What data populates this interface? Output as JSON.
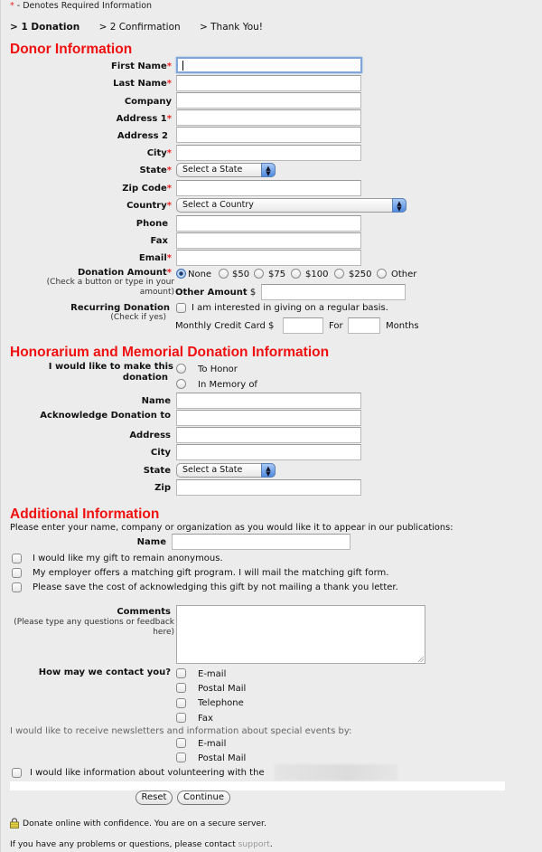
{
  "required_note": {
    "asterisk": "*",
    "text": " - Denotes Required Information"
  },
  "steps": [
    {
      "label": "> 1 Donation",
      "current": true
    },
    {
      "label": "> 2 Confirmation",
      "current": false
    },
    {
      "label": "> Thank You!",
      "current": false
    }
  ],
  "donor": {
    "title": "Donor Information",
    "fields": [
      {
        "label": "First Name",
        "required": true,
        "value": ""
      },
      {
        "label": "Last Name",
        "required": true,
        "value": ""
      },
      {
        "label": "Company",
        "required": false,
        "value": ""
      },
      {
        "label": "Address 1",
        "required": true,
        "value": ""
      },
      {
        "label": "Address 2",
        "required": false,
        "value": ""
      },
      {
        "label": "City",
        "required": true,
        "value": ""
      }
    ],
    "state": {
      "label": "State",
      "required": true,
      "selected": "Select a State"
    },
    "zip": {
      "label": "Zip Code",
      "required": true,
      "value": ""
    },
    "country": {
      "label": "Country",
      "required": true,
      "selected": "Select a Country"
    },
    "phone": {
      "label": "Phone",
      "value": ""
    },
    "fax": {
      "label": "Fax",
      "value": ""
    },
    "email": {
      "label": "Email",
      "required": true,
      "value": ""
    },
    "donation_amount": {
      "label": "Donation Amount",
      "hint": "(Check a button or type in your amount)",
      "options": [
        "None",
        "$50",
        "$75",
        "$100",
        "$250",
        "Other"
      ],
      "selected": "None",
      "other_label": "Other Amount",
      "currency": "$",
      "other_value": ""
    },
    "recurring": {
      "label": "Recurring Donation",
      "hint": "(Check if yes)",
      "checkbox_label": "I am interested in giving on a regular basis.",
      "checked": false,
      "monthly_label": "Monthly Credit Card $",
      "monthly_value": "",
      "for_label": "For",
      "months_value": "",
      "months_label": "Months"
    }
  },
  "honorarium": {
    "title": "Honorarium and Memorial Donation Information",
    "make_label_1": "I would like to make this",
    "make_label_2": "donation",
    "options": [
      "To Honor",
      "In Memory of"
    ],
    "name": {
      "label": "Name",
      "value": ""
    },
    "acknowledge": {
      "label": "Acknowledge Donation to",
      "value": ""
    },
    "address": {
      "label": "Address",
      "value": ""
    },
    "city": {
      "label": "City",
      "value": ""
    },
    "state": {
      "label": "State",
      "selected": "Select a State"
    },
    "zip": {
      "label": "Zip",
      "value": ""
    }
  },
  "additional": {
    "title": "Additional Information",
    "intro": "Please enter your name, company or organization as you would like it to appear in our publications:",
    "name": {
      "label": "Name",
      "value": ""
    },
    "checkboxes": [
      "I would like my gift to remain anonymous.",
      "My employer offers a matching gift program. I will mail the matching gift form.",
      "Please save the cost of acknowledging this gift by not mailing a thank you letter."
    ],
    "comments": {
      "label": "Comments",
      "hint": "(Please type any questions or feedback here)",
      "value": ""
    },
    "contact": {
      "label": "How may we contact you?",
      "options": [
        "E-mail",
        "Postal Mail",
        "Telephone",
        "Fax"
      ]
    },
    "newsletter": {
      "label": "I would like to receive newsletters and information about special events by:",
      "options": [
        "E-mail",
        "Postal Mail"
      ]
    },
    "volunteer": "I would like information about volunteering with the"
  },
  "buttons": {
    "reset": "Reset",
    "continue": "Continue"
  },
  "footer": {
    "secure": "Donate online with confidence. You are on a secure server.",
    "help": "If you have any problems or questions, please contact ",
    "support_link": "support",
    "period": "."
  }
}
